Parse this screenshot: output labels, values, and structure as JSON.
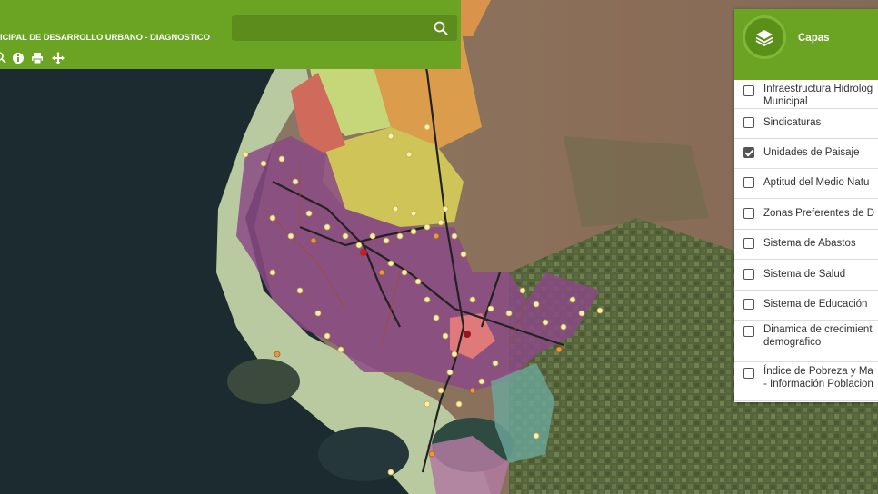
{
  "header": {
    "title": "ICIPAL DE DESARROLLO URBANO - DIAGNOSTICO",
    "search_placeholder": ""
  },
  "toolbar": {
    "icons": [
      "zoom-icon",
      "info-icon",
      "print-icon",
      "pan-icon"
    ]
  },
  "layers_panel": {
    "title": "Capas",
    "items": [
      {
        "label_line1": "Infraestructura Hidrolog",
        "label_line2": "Municipal",
        "checked": false
      },
      {
        "label_line1": "Sindicaturas",
        "label_line2": "",
        "checked": false
      },
      {
        "label_line1": "Unidades de Paisaje",
        "label_line2": "",
        "checked": true
      },
      {
        "label_line1": "Aptitud del Medio Natu",
        "label_line2": "",
        "checked": false
      },
      {
        "label_line1": "Zonas Preferentes de D",
        "label_line2": "",
        "checked": false
      },
      {
        "label_line1": "Sistema de Abastos",
        "label_line2": "",
        "checked": false
      },
      {
        "label_line1": "Sistema de Salud",
        "label_line2": "",
        "checked": false
      },
      {
        "label_line1": "Sistema de Educación",
        "label_line2": "",
        "checked": false
      },
      {
        "label_line1": "Dinamica de crecimient",
        "label_line2": "demografico",
        "checked": false
      },
      {
        "label_line1": "Índice de Pobreza y Ma",
        "label_line2": "- Información Poblacion",
        "checked": false
      }
    ]
  },
  "colors": {
    "header_green": "#6aa422",
    "urban_purple": "#8a4a85",
    "poi_point": "#f4f1b4"
  }
}
